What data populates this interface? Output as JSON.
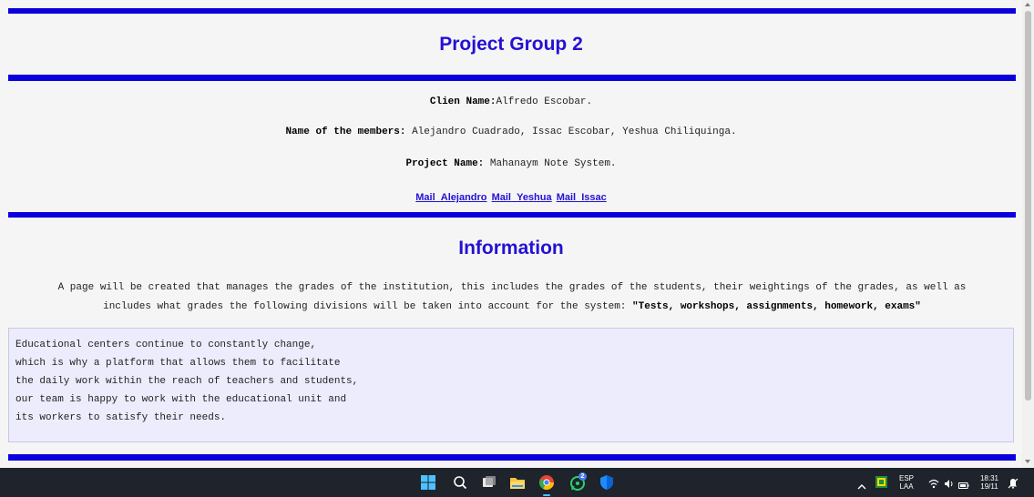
{
  "header": {
    "title": "Project Group 2"
  },
  "project_info": {
    "client_label": "Clien Name:",
    "client_value": "Alfredo Escobar.",
    "members_label": "Name of the members:",
    "members_value": " Alejandro Cuadrado, Issac Escobar, Yeshua Chiliquinga.",
    "project_label": "Project Name:",
    "project_value": " Mahanaym Note System."
  },
  "links": [
    "Mail_Alejandro",
    "Mail_Yeshua",
    "Mail_Issac"
  ],
  "information": {
    "title": "Information",
    "paragraph_1": "A page will be created that manages the grades of the institution, this includes the grades of the students, their weightings of the grades, as well as",
    "paragraph_2": "includes what grades the following divisions will be taken into account for the system: ",
    "paragraph_bold": "\"Tests, workshops, assignments, homework, exams\""
  },
  "quote_box": {
    "lines": [
      "Educational centers continue to constantly change,",
      "which is why a platform that allows them to facilitate",
      "the daily work within the reach of teachers and students,",
      "our team is happy to work with the educational unit and",
      "its workers to satisfy their needs."
    ]
  },
  "taskbar": {
    "icons": [
      "windows-start-icon",
      "search-icon",
      "task-view-icon",
      "file-explorer-icon",
      "chrome-icon",
      "whatsapp-icon",
      "shield-app-icon"
    ],
    "tray": {
      "language": "ESP",
      "layout": "LAA",
      "time": "18:31",
      "date": "19/11"
    },
    "whatsapp_badge": "2"
  },
  "colors": {
    "accent": "#0a00dc",
    "heading": "#2411d4",
    "box_bg": "#ececfd",
    "taskbar_bg": "#1f232b"
  }
}
